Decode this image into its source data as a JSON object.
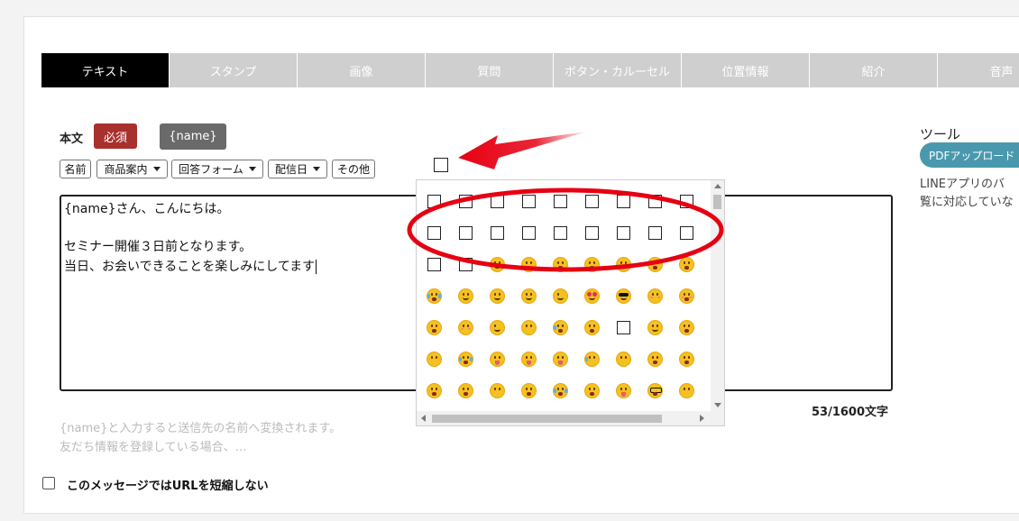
{
  "tabs": [
    {
      "label": "テキスト",
      "active": true
    },
    {
      "label": "スタンプ",
      "active": false
    },
    {
      "label": "画像",
      "active": false
    },
    {
      "label": "質問",
      "active": false
    },
    {
      "label": "ボタン・カルーセル",
      "active": false
    },
    {
      "label": "位置情報",
      "active": false
    },
    {
      "label": "紹介",
      "active": false
    },
    {
      "label": "音声",
      "active": false
    }
  ],
  "body_section": {
    "label": "本文",
    "required_badge": "必須",
    "name_button": "{name}"
  },
  "insert_buttons": [
    {
      "label": "名前",
      "dropdown": false
    },
    {
      "label": "商品案内",
      "dropdown": true
    },
    {
      "label": "回答フォーム",
      "dropdown": true
    },
    {
      "label": "配信日",
      "dropdown": true
    },
    {
      "label": "その他",
      "dropdown": false
    }
  ],
  "message": {
    "lines": [
      "{name}さん、こんにちは。",
      "",
      "セミナー開催３日前となります。",
      "当日、お会いできることを楽しみにしてます"
    ]
  },
  "char_count": "53/1600文字",
  "hints": [
    "{name}と入力すると送信先の名前へ変換されます。",
    "友だち情報を登録している場合、…"
  ],
  "no_shorten_url_label": "このメッセージではURLを短縮しない",
  "no_shorten_url_checked": false,
  "tools": {
    "title": "ツール",
    "pdf_button": "PDFアップロード",
    "text_lines": [
      "LINEアプリのバ",
      "覧に対応していな"
    ]
  },
  "emoji_picker": {
    "rows": [
      [
        "box",
        "box",
        "box",
        "box",
        "box",
        "box",
        "box",
        "box",
        "box"
      ],
      [
        "box",
        "box",
        "box",
        "box",
        "box",
        "box",
        "box",
        "box",
        "box"
      ],
      [
        "box",
        "box",
        "grin",
        "smile",
        "grimace",
        "teeth",
        "smirk",
        "sleepy",
        "laugh"
      ],
      [
        "joy",
        "grin",
        "sly",
        "smile",
        "wink",
        "heart-eyes",
        "sunglasses",
        "pout",
        "blush"
      ],
      [
        "open-mouth",
        "kiss",
        "wink",
        "sad",
        "cry",
        "frown",
        "box",
        "smirk",
        "surprised"
      ],
      [
        "neutral",
        "dizzy",
        "tongue",
        "tongue",
        "tongue",
        "disappointed",
        "neutral",
        "worried",
        "surprised"
      ],
      [
        "laugh",
        "angry",
        "sad",
        "grimace",
        "joy",
        "fear",
        "confused",
        "nerd",
        "sad"
      ]
    ]
  },
  "colors": {
    "active_tab": "#000000",
    "inactive_tab": "#cfcfcf",
    "required_badge": "#a8312e",
    "name_button": "#6a6a6a",
    "pdf_button": "#4a98ad",
    "annotation": "#e60012",
    "emoji_face": "#f5c021"
  }
}
